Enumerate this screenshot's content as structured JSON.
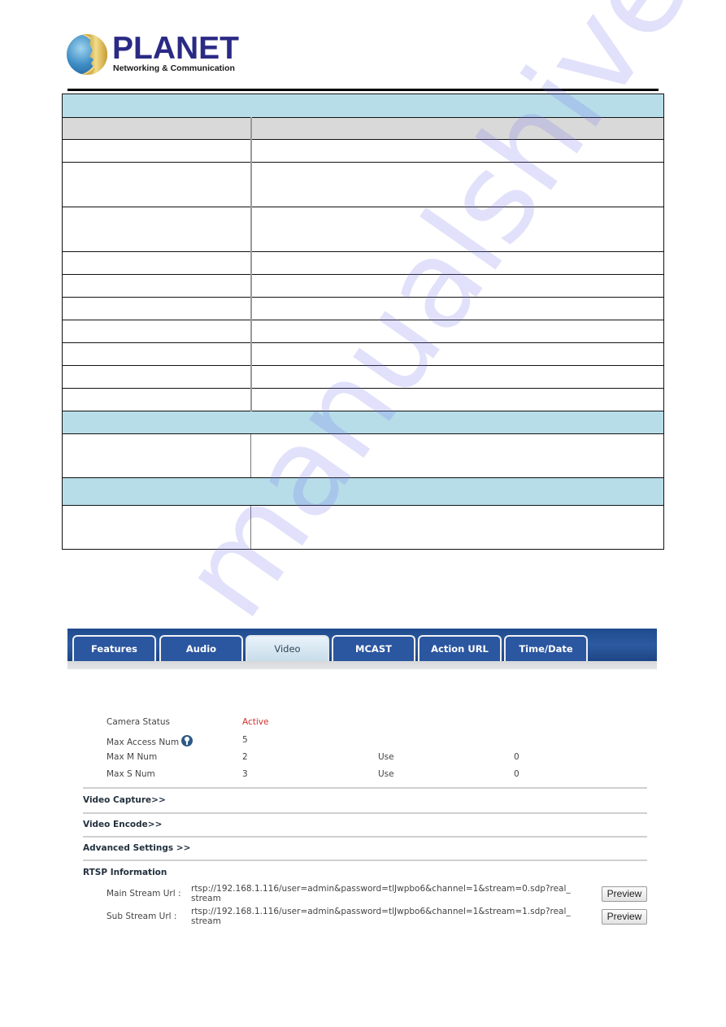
{
  "header": {
    "brand": "PLANET",
    "tagline": "Networking & Communication"
  },
  "spec_table": {
    "rows": [
      {
        "type": "section",
        "text": ""
      },
      {
        "type": "header",
        "cells": [
          "",
          ""
        ]
      },
      {
        "type": "row",
        "cells": [
          "",
          ""
        ]
      },
      {
        "type": "row",
        "cells": [
          "",
          ""
        ]
      },
      {
        "type": "row",
        "cells": [
          "",
          ""
        ]
      },
      {
        "type": "row",
        "cells": [
          "",
          ""
        ]
      },
      {
        "type": "row",
        "cells": [
          "",
          ""
        ]
      },
      {
        "type": "row",
        "cells": [
          "",
          ""
        ]
      },
      {
        "type": "row",
        "cells": [
          "",
          ""
        ]
      },
      {
        "type": "row",
        "cells": [
          "",
          ""
        ]
      },
      {
        "type": "row",
        "cells": [
          "",
          ""
        ]
      },
      {
        "type": "row",
        "cells": [
          "",
          ""
        ]
      },
      {
        "type": "section",
        "text": ""
      },
      {
        "type": "row",
        "cells": [
          "",
          ""
        ]
      },
      {
        "type": "section",
        "text": ""
      },
      {
        "type": "row",
        "cells": [
          "",
          ""
        ]
      }
    ]
  },
  "watermark": "manualshive.com",
  "camera_ui": {
    "tabs": [
      {
        "label": "Features",
        "active": false
      },
      {
        "label": "Audio",
        "active": false
      },
      {
        "label": "Video",
        "active": true
      },
      {
        "label": "MCAST",
        "active": false
      },
      {
        "label": "Action URL",
        "active": false
      },
      {
        "label": "Time/Date",
        "active": false
      }
    ],
    "status": {
      "camera_status_label": "Camera Status",
      "camera_status_value": "Active",
      "camera_status_color": "#d0302f",
      "max_access_label": "Max Access Num",
      "max_access_value": "5",
      "max_m_label": "Max M Num",
      "max_m_value": "2",
      "max_m_use_label": "Use",
      "max_m_use_value": "0",
      "max_s_label": "Max S Num",
      "max_s_value": "3",
      "max_s_use_label": "Use",
      "max_s_use_value": "0"
    },
    "sections": {
      "video_capture": "Video Capture>>",
      "video_encode": "Video Encode>>",
      "advanced_settings": "Advanced Settings >>",
      "rtsp_information": "RTSP Information"
    },
    "rtsp": {
      "main_label": "Main Stream Url :",
      "main_url": "rtsp://192.168.1.116/user=admin&password=tlJwpbo6&channel=1&stream=0.sdp?real_stream",
      "sub_label": "Sub Stream Url :",
      "sub_url": "rtsp://192.168.1.116/user=admin&password=tlJwpbo6&channel=1&stream=1.sdp?real_stream",
      "preview_label": "Preview"
    }
  }
}
